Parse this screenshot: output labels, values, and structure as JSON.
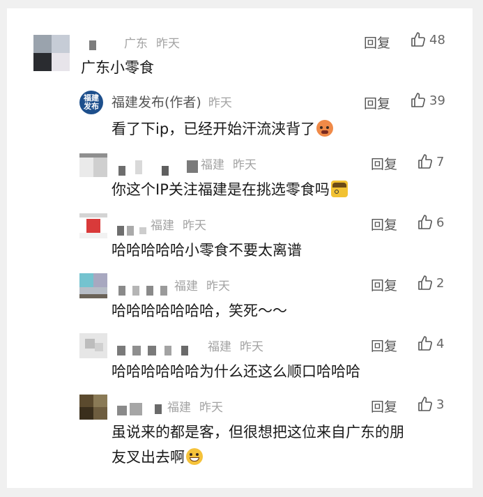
{
  "colors": {
    "background": "#f0f0f0",
    "card": "#ffffff",
    "meta": "#a3a3a3",
    "action": "#555555"
  },
  "icons": {
    "like": "thumbs-up-outline-icon"
  },
  "comments": [
    {
      "name": "",
      "location": "广东",
      "time": "昨天",
      "reply": "回复",
      "likes": "48",
      "text": "广东小零食"
    },
    {
      "name": "福建发布(作者)",
      "logo_text": "福建发布",
      "location": "",
      "time": "昨天",
      "reply": "回复",
      "likes": "39",
      "text": "看了下ip，已经开始汗流浃背了",
      "emoji": "sweating-face-emoji"
    },
    {
      "name": "",
      "location": "福建",
      "time": "昨天",
      "reply": "回复",
      "likes": "7",
      "text": "你这个IP关注福建是在挑选零食吗",
      "emoji": "detective-emoji"
    },
    {
      "name": "",
      "location": "福建",
      "time": "昨天",
      "reply": "回复",
      "likes": "6",
      "text": "哈哈哈哈哈小零食不要太离谱"
    },
    {
      "name": "",
      "location": "福建",
      "time": "昨天",
      "reply": "回复",
      "likes": "2",
      "text": "哈哈哈哈哈哈哈，笑死～～"
    },
    {
      "name": "",
      "location": "福建",
      "time": "昨天",
      "reply": "回复",
      "likes": "4",
      "text": "哈哈哈哈哈哈为什么还这么顺口哈哈哈"
    },
    {
      "name": "",
      "location": "福建",
      "time": "昨天",
      "reply": "回复",
      "likes": "3",
      "text_line1": "虽说来的都是客，但很想把这位来自广东的朋",
      "text_line2": "友叉出去啊",
      "emoji": "grinning-sweat-emoji"
    }
  ]
}
